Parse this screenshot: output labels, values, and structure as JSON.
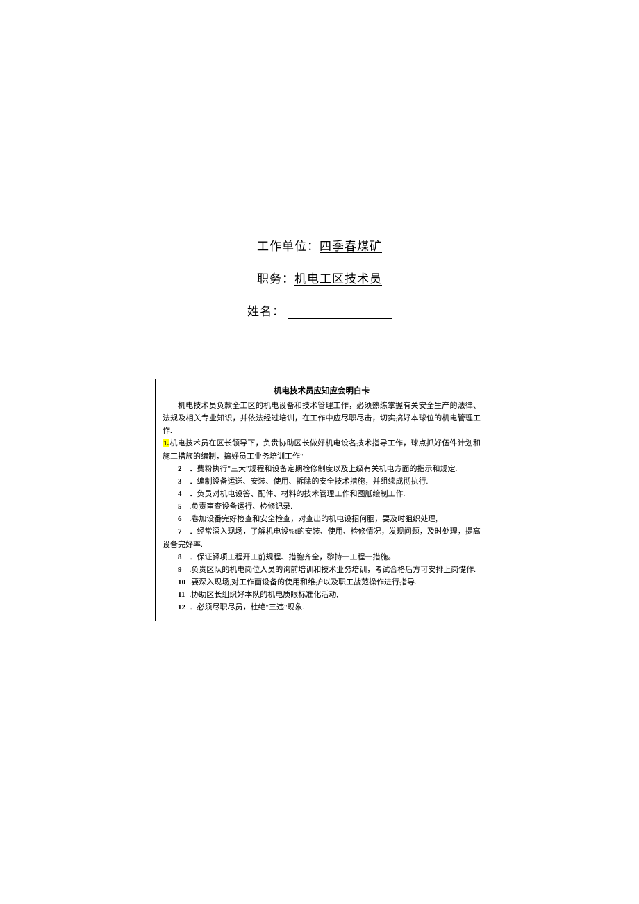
{
  "header": {
    "unit_label": "工作单位：",
    "unit_value": "四季春煤矿",
    "position_label": "职务：",
    "position_value": "机电工区技术员",
    "name_label": "姓名："
  },
  "card": {
    "title": "机电技术员应知应会明白卡",
    "intro": "机电技术员负款全工区的机电设备和技术管理工作，必须熟练掌握有关安全生产的法律、法规及相关专业知识，并依法经过培训，在工作中应尽职尽击，切实搞好本球位的机电管理工作.",
    "item1_marker": "1.",
    "item1_text": "机电技术员在区长领导下，负贵协助区长做好机电设名技术指导工作，球点抓好伍件计划和施工措族的编制，搞好员工业务培训工作\"",
    "items": [
      {
        "num": "2",
        "text": "．费粉执行\"三大\"规程和设备定期检修制度以及上级有关机电方面的指示和规定."
      },
      {
        "num": "3",
        "text": "．编制设备运送、安装、使用、拆除的安全技术措施，并组续成彻执行."
      },
      {
        "num": "4",
        "text": "．负员对机电设答、配件、材料的技术管理工作和图胝绘制工作."
      },
      {
        "num": "5",
        "text": ".负责审查设备运行、检修记录."
      },
      {
        "num": "6",
        "text": ".卷加设番完好检查和安全检查，对查出的机电设招何胭，要及时狙织处理,"
      },
      {
        "num": "7",
        "text": "．经常深入现场，了解机电设%t的安装、使用、检修情况，发现问题，及时处理，提高"
      }
    ],
    "item7_cont": "设备完好率.",
    "items2": [
      {
        "num": "8",
        "text": "．保证铎项工程开工前规程、措胞齐全，黎持一工程一措施。"
      },
      {
        "num": "9",
        "text": ".负贵区队的机电岗位人员的询前培训和技术业务培训，考试合格后方可安排上岗憷作."
      },
      {
        "num": "10",
        "text": ".要深入现场,对工作面设备的使用和维护以及职工战范操作进行指导."
      },
      {
        "num": "11",
        "text": ".协助区长组织好本队的机电质眼标准化活动,"
      },
      {
        "num": "12",
        "text": "．必须尽职尽员，杜绝\"三违\"现象."
      }
    ]
  }
}
